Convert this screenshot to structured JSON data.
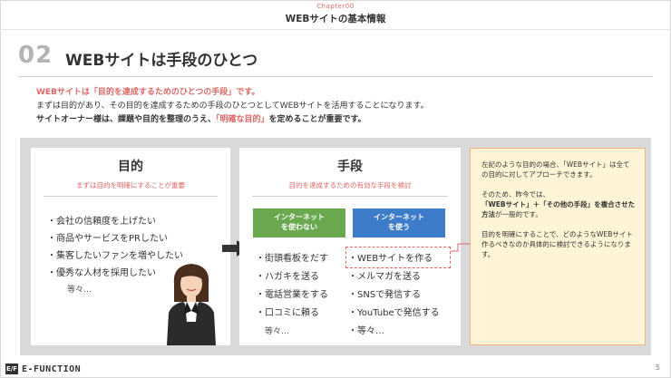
{
  "header": {
    "chapter": "Chapter00",
    "title": "WEBサイトの基本情報"
  },
  "section": {
    "number": "02",
    "title": "WEBサイトは手段のひとつ"
  },
  "intro": {
    "line1": "WEBサイトは「目的を達成するためのひとつの手段」です。",
    "line2": "まずは目的があり、その目的を達成するための手段のひとつとしてWEBサイトを活用することになります。",
    "line3_pre": "サイトオーナー様は、課題や目的を整理のうえ、",
    "line3_red": "「明確な目的」",
    "line3_post": "を定めることが重要です。"
  },
  "goal": {
    "title": "目的",
    "subtitle": "まずは目的を明確にすることが重要",
    "items": [
      "会社の信頼度を上げたい",
      "商品やサービスをPRしたい",
      "集客したいファンを増やしたい",
      "優秀な人材を採用したい"
    ],
    "etc": "等々…"
  },
  "means": {
    "title": "手段",
    "subtitle": "目的を達成するための有効な手段を検討",
    "no_internet": {
      "label_l1": "インターネット",
      "label_l2": "を使わない",
      "items": [
        "街頭看板をだす",
        "ハガキを送る",
        "電話営業をする",
        "口コミに頼る"
      ],
      "etc": "等々…"
    },
    "internet": {
      "label_l1": "インターネット",
      "label_l2": "を使う",
      "items": [
        "WEBサイトを作る",
        "メルマガを送る",
        "SNSで発信する",
        "YouTubeで発信する"
      ],
      "etc": "等々…"
    }
  },
  "note": {
    "p1": "左記のような目的の場合、「WEBサイト」は全ての目的に対してアプローチできます。",
    "p2_pre": "そのため、昨今では、",
    "p2_bold": "「WEBサイト」＋「その他の手段」を複合させた方法",
    "p2_post": "が一般的です。",
    "p3": "目的を明確にすることで、どのようなWEBサイト作るべきなのか具体的に検討できるようになります。"
  },
  "footer": {
    "logo_mark": "E/F",
    "logo_text": "E-FUNCTION",
    "page": "5"
  },
  "colors": {
    "accent_red": "#e06666",
    "green": "#6aa84f",
    "blue": "#3d7cc9",
    "note_bg": "#fff4d6",
    "note_border": "#f4b183"
  }
}
